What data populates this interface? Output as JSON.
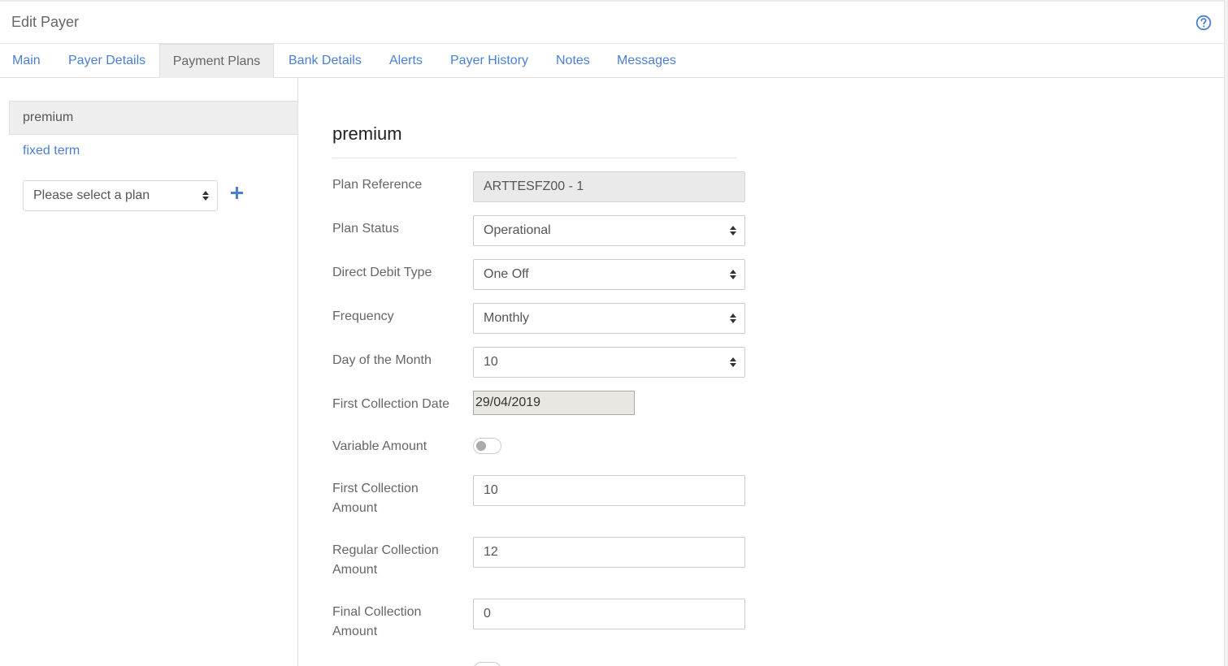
{
  "header": {
    "title": "Edit Payer",
    "help_icon": "question-circle-icon"
  },
  "tabs": [
    {
      "label": "Main",
      "active": false
    },
    {
      "label": "Payer Details",
      "active": false
    },
    {
      "label": "Payment Plans",
      "active": true
    },
    {
      "label": "Bank Details",
      "active": false
    },
    {
      "label": "Alerts",
      "active": false
    },
    {
      "label": "Payer History",
      "active": false
    },
    {
      "label": "Notes",
      "active": false
    },
    {
      "label": "Messages",
      "active": false
    }
  ],
  "sidebar": {
    "plans": [
      {
        "label": "premium",
        "active": true
      },
      {
        "label": "fixed term",
        "active": false
      }
    ],
    "select_plan": {
      "value": "Please select a plan"
    },
    "add_icon": "plus-icon"
  },
  "form": {
    "title": "premium",
    "plan_reference": {
      "label": "Plan Reference",
      "value": "ARTTESFZ00 - 1"
    },
    "plan_status": {
      "label": "Plan Status",
      "value": "Operational"
    },
    "direct_debit_type": {
      "label": "Direct Debit Type",
      "value": "One Off"
    },
    "frequency": {
      "label": "Frequency",
      "value": "Monthly"
    },
    "day_of_month": {
      "label": "Day of the Month",
      "value": "10"
    },
    "first_collection_date": {
      "label": "First Collection Date",
      "value": "29/04/2019"
    },
    "variable_amount": {
      "label": "Variable Amount",
      "enabled": false
    },
    "first_collection_amount": {
      "label_line1": "First Collection",
      "label_line2": "Amount",
      "value": "10"
    },
    "regular_collection_amount": {
      "label_line1": "Regular Collection",
      "label_line2": "Amount",
      "value": "12"
    },
    "final_collection_amount": {
      "label_line1": "Final Collection",
      "label_line2": "Amount",
      "value": "0"
    }
  },
  "colors": {
    "link": "#4a7fd3",
    "active_tab_bg": "#eeeeee",
    "readonly_bg": "#eaeaea"
  }
}
